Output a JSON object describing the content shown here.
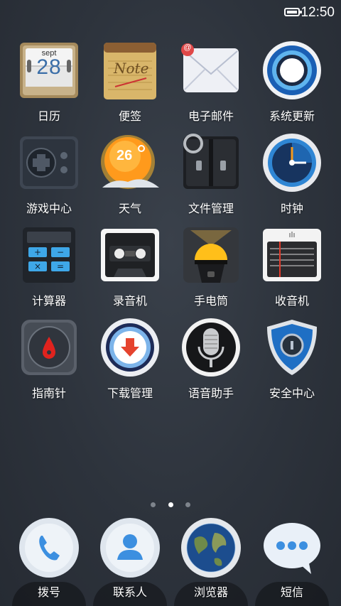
{
  "status": {
    "time": "12:50",
    "battery_level": 0.85
  },
  "apps": [
    {
      "label": "日历",
      "icon": "calendar-icon",
      "month": "sept",
      "day": "28"
    },
    {
      "label": "便签",
      "icon": "notepad-icon",
      "note_text": "Note"
    },
    {
      "label": "电子邮件",
      "icon": "email-icon",
      "badge": "@"
    },
    {
      "label": "系统更新",
      "icon": "update-icon"
    },
    {
      "label": "游戏中心",
      "icon": "gamepad-icon"
    },
    {
      "label": "天气",
      "icon": "weather-sun-icon",
      "temp": "26"
    },
    {
      "label": "文件管理",
      "icon": "file-manager-icon"
    },
    {
      "label": "时钟",
      "icon": "clock-icon"
    },
    {
      "label": "计算器",
      "icon": "calculator-icon"
    },
    {
      "label": "录音机",
      "icon": "cassette-icon"
    },
    {
      "label": "手电筒",
      "icon": "flashlight-icon"
    },
    {
      "label": "收音机",
      "icon": "radio-icon"
    },
    {
      "label": "指南针",
      "icon": "compass-icon"
    },
    {
      "label": "下载管理",
      "icon": "download-icon"
    },
    {
      "label": "语音助手",
      "icon": "microphone-icon"
    },
    {
      "label": "安全中心",
      "icon": "shield-lock-icon"
    }
  ],
  "pager": {
    "count": 3,
    "active": 2
  },
  "dock": [
    {
      "label": "拨号",
      "icon": "phone-icon"
    },
    {
      "label": "联系人",
      "icon": "contacts-icon"
    },
    {
      "label": "浏览器",
      "icon": "globe-icon"
    },
    {
      "label": "短信",
      "icon": "message-icon"
    }
  ]
}
